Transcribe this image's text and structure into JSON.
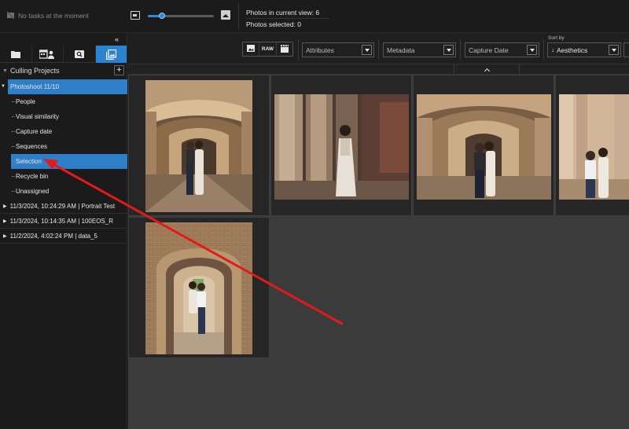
{
  "topbar": {
    "task_status": "No tasks at the moment",
    "zoom_value": 0.22,
    "photos_in_view": "Photos in current view: 6",
    "photos_selected": "Photos selected: 0"
  },
  "sidebar": {
    "collapse_glyph": "«",
    "tabs": [
      {
        "icon": "folder-icon",
        "active": false
      },
      {
        "icon": "calendar-people-icon",
        "active": false
      },
      {
        "icon": "search-icon",
        "active": false
      },
      {
        "icon": "gallery-icon",
        "active": true
      }
    ],
    "section_title": "Culling Projects",
    "add_label": "+",
    "shoot": {
      "label": "Photoshoot 11/10",
      "children": [
        "People",
        "Visual similarity",
        "Capture date",
        "Sequences",
        "Selection",
        "Recycle bin",
        "Unassigned"
      ],
      "selected": "Selection"
    },
    "projects": [
      "11/3/2024, 10:24:29 AM | Portrait Test",
      "11/3/2024, 10:14:35 AM | 100EOS_R",
      "11/2/2024, 4:02:24 PM | data_5"
    ]
  },
  "toolbar": {
    "raw_label": "RAW",
    "attributes_label": "Attributes",
    "metadata_label": "Metadata",
    "capture_date_label": "Capture Date",
    "sort_by_label": "Sort by",
    "sort_value": "Aesthetics",
    "sort_direction_glyph": "↓"
  },
  "grid": {
    "photo_count": 6
  },
  "colors": {
    "accent": "#2f7fc8",
    "annotation_arrow": "#e21a1a"
  }
}
